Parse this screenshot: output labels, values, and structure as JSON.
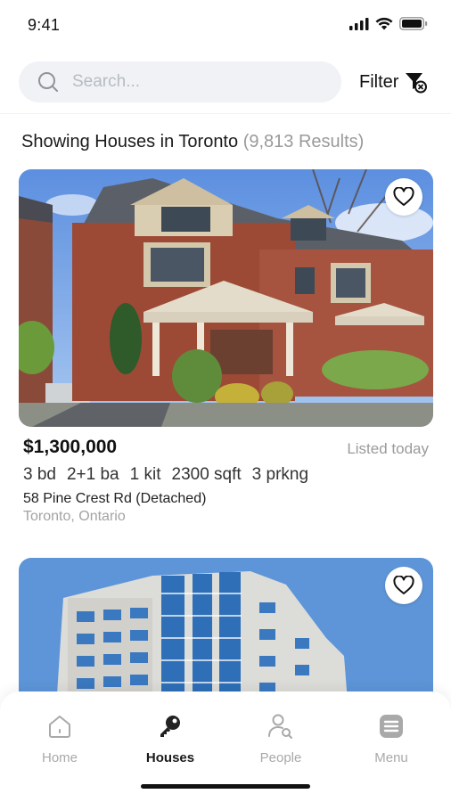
{
  "status_bar": {
    "time": "9:41"
  },
  "search": {
    "placeholder": "Search...",
    "value": ""
  },
  "filter": {
    "label": "Filter"
  },
  "results": {
    "prefix": "Showing Houses in Toronto",
    "count": "(9,813 Results)"
  },
  "listings": [
    {
      "price": "$1,300,000",
      "listed": "Listed today",
      "beds": "3 bd",
      "baths": "2+1 ba",
      "kitchens": "1 kit",
      "area": "2300 sqft",
      "parking": "3 prkng",
      "address": "58 Pine Crest Rd (Detached)",
      "city": "Toronto, Ontario"
    }
  ],
  "nav": {
    "items": [
      {
        "label": "Home",
        "icon": "home-icon",
        "active": false
      },
      {
        "label": "Houses",
        "icon": "key-icon",
        "active": true
      },
      {
        "label": "People",
        "icon": "person-search-icon",
        "active": false
      },
      {
        "label": "Menu",
        "icon": "menu-icon",
        "active": false
      }
    ]
  },
  "colors": {
    "accent": "#1a1a1a",
    "muted": "#a9a9a9",
    "search_bg": "#f0f2f5"
  }
}
